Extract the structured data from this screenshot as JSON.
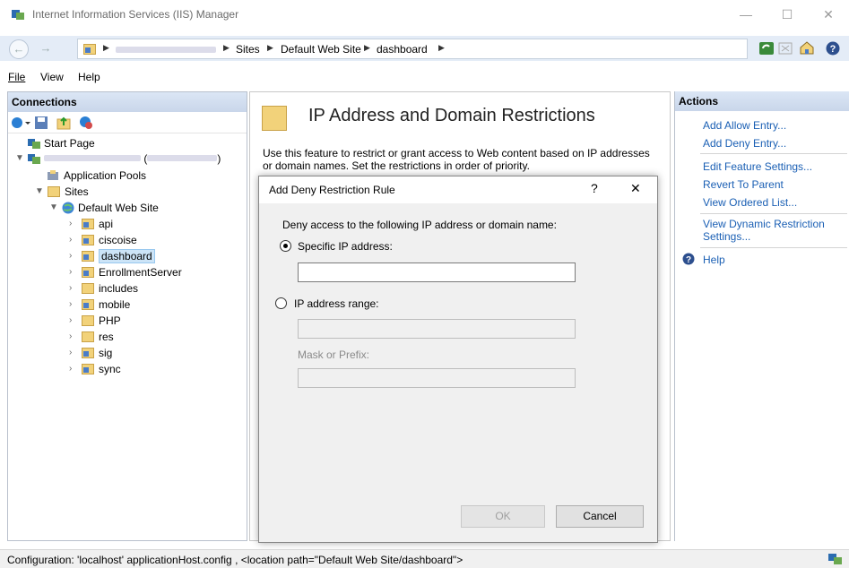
{
  "window": {
    "title": "Internet Information Services (IIS) Manager",
    "minimize": "—",
    "maximize": "☐",
    "close": "✕"
  },
  "breadcrumb": {
    "items": [
      "Sites",
      "Default Web Site",
      "dashboard"
    ]
  },
  "menu": {
    "file": "File",
    "view": "View",
    "help": "Help"
  },
  "connections": {
    "title": "Connections",
    "start_page": "Start Page",
    "server_paren": "(",
    "server_paren_close": ")",
    "app_pools": "Application Pools",
    "sites": "Sites",
    "default_site": "Default Web Site",
    "children": [
      "api",
      "ciscoise",
      "dashboard",
      "EnrollmentServer",
      "includes",
      "mobile",
      "PHP",
      "res",
      "sig",
      "sync"
    ]
  },
  "feature": {
    "title": "IP Address and Domain Restrictions",
    "description": "Use this feature to restrict or grant access to Web content based on IP addresses or domain names. Set the restrictions in order of priority."
  },
  "dialog": {
    "title": "Add Deny Restriction Rule",
    "help": "?",
    "close": "✕",
    "prompt": "Deny access to the following IP address or domain name:",
    "specific_ip_label": "Specific IP address:",
    "specific_ip_value": "",
    "range_label": "IP address range:",
    "range_value": "",
    "mask_label": "Mask or Prefix:",
    "mask_value": "",
    "ok": "OK",
    "cancel": "Cancel"
  },
  "actions": {
    "title": "Actions",
    "items": [
      "Add Allow Entry...",
      "Add Deny Entry...",
      "Edit Feature Settings...",
      "Revert To Parent",
      "View Ordered List...",
      "View Dynamic Restriction Settings...",
      "Help"
    ]
  },
  "status": {
    "text": "Configuration: 'localhost' applicationHost.config , <location path=\"Default Web Site/dashboard\">"
  }
}
